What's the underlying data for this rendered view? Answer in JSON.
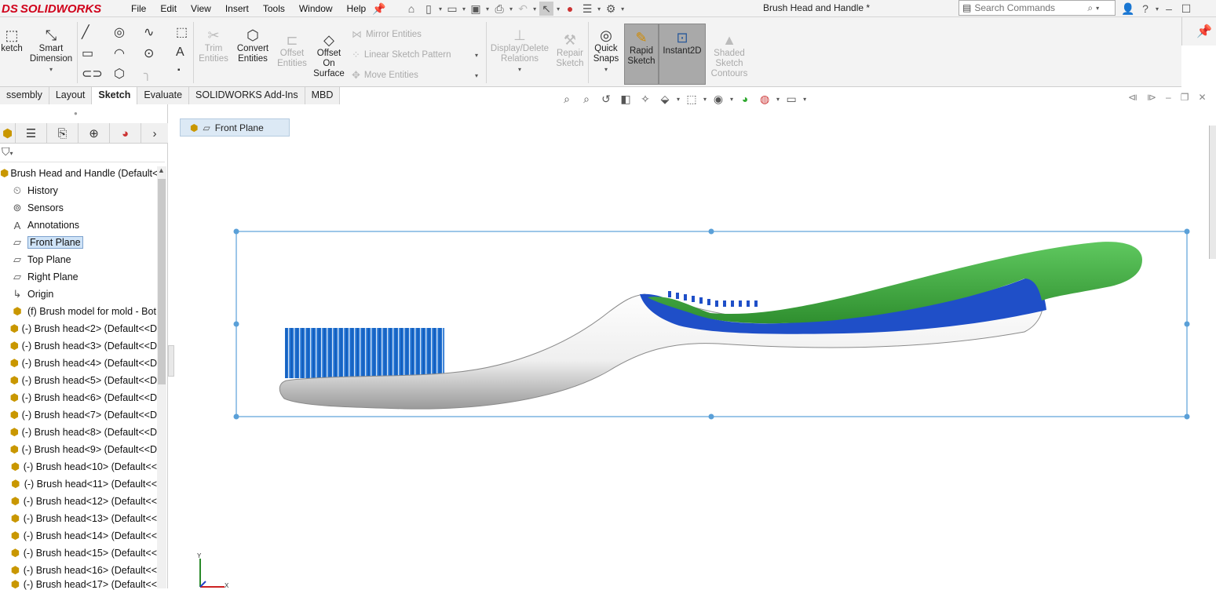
{
  "app": {
    "logo_text": "SOLIDWORKS",
    "logo_prefix": "DS",
    "document_title": "Brush Head and Handle *"
  },
  "menu": [
    "File",
    "Edit",
    "View",
    "Insert",
    "Tools",
    "Window",
    "Help"
  ],
  "search": {
    "placeholder": "Search Commands"
  },
  "ribbon": {
    "sketch": "ketch",
    "smart_dimension": "Smart\nDimension",
    "trim_entities": "Trim\nEntities",
    "convert_entities": "Convert\nEntities",
    "offset_entities": "Offset\nEntities",
    "offset_on_surface": "Offset\nOn\nSurface",
    "mirror_entities": "Mirror Entities",
    "linear_sketch_pattern": "Linear Sketch Pattern",
    "move_entities": "Move Entities",
    "display_delete_relations": "Display/Delete\nRelations",
    "repair_sketch": "Repair\nSketch",
    "quick_snaps": "Quick\nSnaps",
    "rapid_sketch": "Rapid\nSketch",
    "instant2d": "Instant2D",
    "shaded_sketch_contours": "Shaded\nSketch\nContours"
  },
  "tabs": [
    "ssembly",
    "Layout",
    "Sketch",
    "Evaluate",
    "SOLIDWORKS Add-Ins",
    "MBD"
  ],
  "active_tab": "Sketch",
  "breadcrumb": {
    "label": "Front Plane"
  },
  "tree": {
    "root": "Brush Head and Handle  (Default<D",
    "items": [
      {
        "label": "History",
        "icon": "history-icon"
      },
      {
        "label": "Sensors",
        "icon": "sensors-icon"
      },
      {
        "label": "Annotations",
        "icon": "annotations-icon"
      },
      {
        "label": "Front Plane",
        "icon": "plane-icon",
        "selected": true
      },
      {
        "label": "Top Plane",
        "icon": "plane-icon"
      },
      {
        "label": "Right Plane",
        "icon": "plane-icon"
      },
      {
        "label": "Origin",
        "icon": "origin-icon"
      },
      {
        "label": "(f) Brush model for mold - Bot",
        "icon": "part-icon"
      },
      {
        "label": "(-) Brush head<2> (Default<<D",
        "icon": "part-icon"
      },
      {
        "label": "(-) Brush head<3> (Default<<D",
        "icon": "part-icon"
      },
      {
        "label": "(-) Brush head<4> (Default<<D",
        "icon": "part-icon"
      },
      {
        "label": "(-) Brush head<5> (Default<<D",
        "icon": "part-icon"
      },
      {
        "label": "(-) Brush head<6> (Default<<D",
        "icon": "part-icon"
      },
      {
        "label": "(-) Brush head<7> (Default<<D",
        "icon": "part-icon"
      },
      {
        "label": "(-) Brush head<8> (Default<<D",
        "icon": "part-icon"
      },
      {
        "label": "(-) Brush head<9> (Default<<D",
        "icon": "part-icon"
      },
      {
        "label": "(-) Brush head<10> (Default<<",
        "icon": "part-icon"
      },
      {
        "label": "(-) Brush head<11> (Default<<",
        "icon": "part-icon"
      },
      {
        "label": "(-) Brush head<12> (Default<<",
        "icon": "part-icon"
      },
      {
        "label": "(-) Brush head<13> (Default<<",
        "icon": "part-icon"
      },
      {
        "label": "(-) Brush head<14> (Default<<",
        "icon": "part-icon"
      },
      {
        "label": "(-) Brush head<15> (Default<<",
        "icon": "part-icon"
      },
      {
        "label": "(-) Brush head<16> (Default<<",
        "icon": "part-icon"
      },
      {
        "label": "(-) Brush head<17> (Default<<",
        "icon": "part-icon"
      }
    ]
  },
  "triad": {
    "x": "X",
    "y": "Y"
  },
  "colors": {
    "handle_green": "#3fa33f",
    "grip_blue": "#1f4fc8",
    "bristle_blue": "#1e6fd0",
    "body_white": "#f2f2f2",
    "selection_box": "#5aa0d8"
  }
}
